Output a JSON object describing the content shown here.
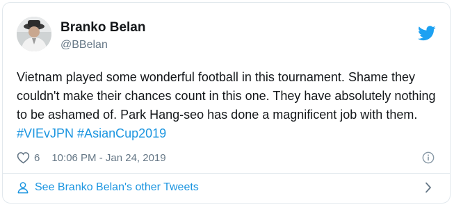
{
  "author": {
    "name": "Branko Belan",
    "handle": "@BBelan"
  },
  "tweet": {
    "text": "Vietnam played some wonderful football in this tournament. Shame they couldn't make their chances count in this one. They have absolutely nothing to be ashamed of. Park Hang-seo has done a magnificent job with them.",
    "hashtags": [
      "#VIEvJPN",
      "#AsianCup2019"
    ],
    "likes": "6",
    "timestamp": "10:06 PM - Jan 24, 2019"
  },
  "footer": {
    "see_more_label": "See Branko Belan's other Tweets"
  },
  "colors": {
    "link": "#1b95e0",
    "secondary_text": "#657786",
    "primary_text": "#14171a",
    "border": "#e1e8ed",
    "twitter_blue": "#1da1f2"
  },
  "icons": [
    "avatar",
    "twitter-logo-icon",
    "heart-icon",
    "info-icon",
    "person-icon",
    "chevron-right-icon"
  ]
}
